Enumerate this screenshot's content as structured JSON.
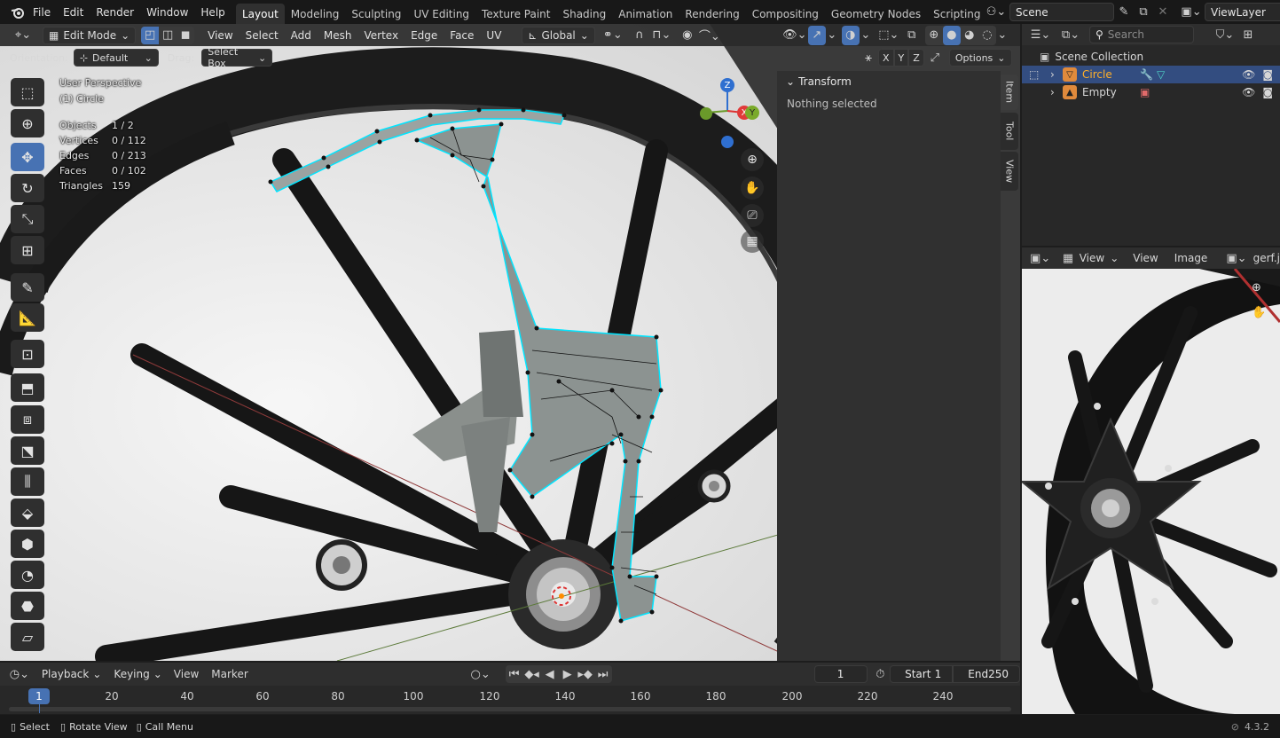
{
  "app": {
    "version": "4.3.2"
  },
  "menubar": {
    "file": "File",
    "edit": "Edit",
    "render": "Render",
    "window": "Window",
    "help": "Help"
  },
  "workspaces": [
    "Layout",
    "Modeling",
    "Sculpting",
    "UV Editing",
    "Texture Paint",
    "Shading",
    "Animation",
    "Rendering",
    "Compositing",
    "Geometry Nodes",
    "Scripting"
  ],
  "scene": {
    "name": "Scene",
    "view_layer": "ViewLayer"
  },
  "viewport_header": {
    "mode": "Edit Mode",
    "menus": [
      "View",
      "Select",
      "Add",
      "Mesh",
      "Vertex",
      "Edge",
      "Face",
      "UV"
    ],
    "transform_orientation": "Global"
  },
  "tool_settings": {
    "orientation_label": "Orientation:",
    "orientation_value": "Default",
    "drag_label": "Drag:",
    "drag_value": "Select Box",
    "axes": [
      "X",
      "Y",
      "Z"
    ],
    "options": "Options"
  },
  "viewport_overlay": {
    "view_name": "User Perspective",
    "object_name": "(1) Circle",
    "stats": [
      {
        "label": "Objects",
        "value": "1 / 2"
      },
      {
        "label": "Vertices",
        "value": "0 / 112"
      },
      {
        "label": "Edges",
        "value": "0 / 213"
      },
      {
        "label": "Faces",
        "value": "0 / 102"
      },
      {
        "label": "Triangles",
        "value": "159"
      }
    ]
  },
  "gizmo": {
    "z": "Z",
    "x": "X",
    "y": "Y"
  },
  "sidebar": {
    "panel_title": "Transform",
    "message": "Nothing selected",
    "tabs": [
      "Item",
      "Tool",
      "View"
    ]
  },
  "outliner": {
    "search_placeholder": "Search",
    "root": "Scene Collection",
    "items": [
      {
        "name": "Circle",
        "active": true
      },
      {
        "name": "Empty",
        "active": false
      }
    ]
  },
  "image_editor": {
    "menus": [
      "View",
      "View",
      "Image"
    ],
    "image_name": "gerf.j"
  },
  "timeline": {
    "menus": [
      "Playback",
      "Keying",
      "View",
      "Marker"
    ],
    "current_frame": "1",
    "start_label": "Start",
    "start": "1",
    "end_label": "End",
    "end": "250",
    "ticks": [
      "1",
      "20",
      "40",
      "60",
      "80",
      "100",
      "120",
      "140",
      "160",
      "180",
      "200",
      "220",
      "240"
    ]
  },
  "statusbar": {
    "items": [
      "Select",
      "Rotate View",
      "Call Menu"
    ],
    "version": "4.3.2"
  },
  "colors": {
    "accent": "#4772b3",
    "active_text": "#ffaf29",
    "edge_highlight": "#00e5ff"
  }
}
